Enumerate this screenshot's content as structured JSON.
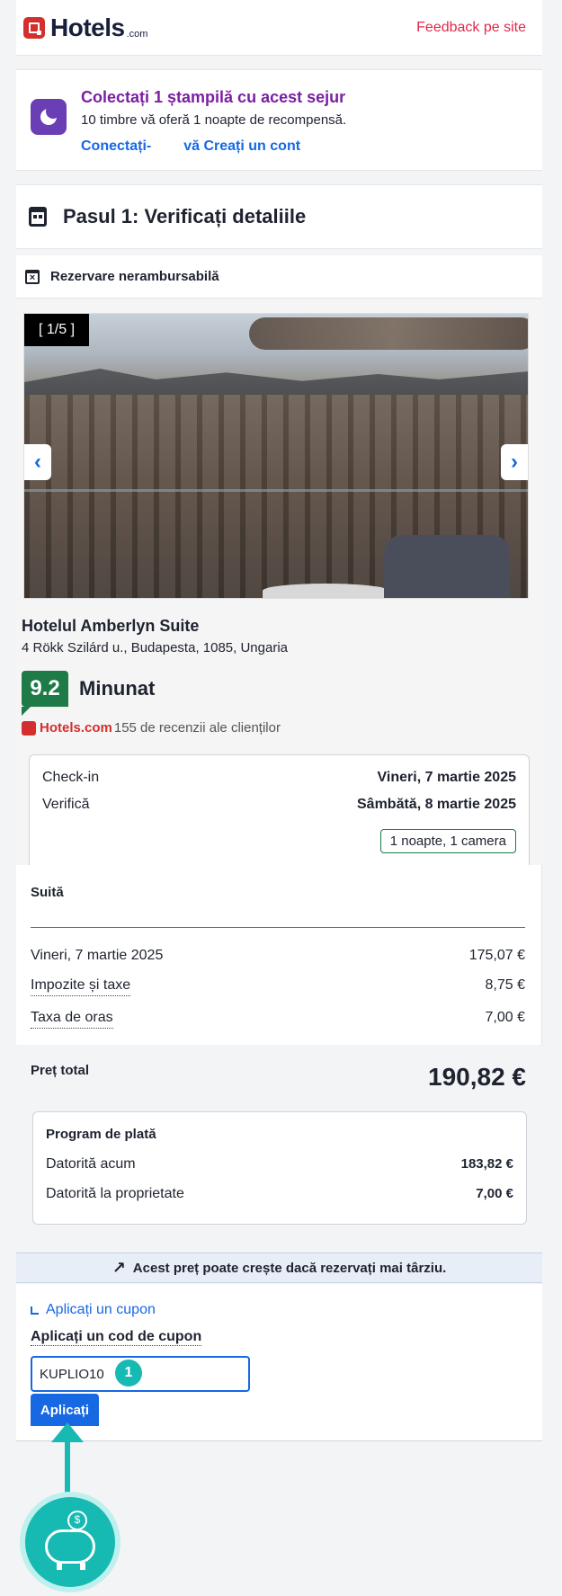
{
  "header": {
    "logo_text": "Hotels",
    "logo_suffix": ".com",
    "feedback_link": "Feedback pe site"
  },
  "loyalty": {
    "title": "Colectați 1 ștampilă cu acest sejur",
    "subtitle": "10 timbre vă oferă 1 noapte de recompensă.",
    "signin_link": "Conectați-",
    "create_link": "vă Creați un cont"
  },
  "step": {
    "title": "Pasul 1: Verificați detaliile"
  },
  "refund": {
    "label": "Rezervare nerambursabilă"
  },
  "gallery": {
    "counter": "[ 1/5 ]",
    "prev": "‹",
    "next": "›"
  },
  "hotel": {
    "name": "Hotelul Amberlyn Suite",
    "address": "4 Rökk Szilárd u., Budapesta, 1085, Ungaria",
    "score": "9.2",
    "rating_word": "Minunat",
    "review_brand": "Hotels.com",
    "review_text": "155 de recenzii ale clienților"
  },
  "stay": {
    "checkin_label": "Check-in",
    "checkin_value": "Vineri, 7 martie 2025",
    "checkout_label": "Verifică",
    "checkout_value": "Sâmbătă, 8 martie 2025",
    "summary": "1 noapte, 1 camera"
  },
  "price": {
    "room_type": "Suită",
    "lines": [
      {
        "label": "Vineri, 7 martie 2025",
        "value": "175,07 €"
      },
      {
        "label": "Impozite și taxe",
        "value": "8,75 €"
      },
      {
        "label": "Taxa de oras",
        "value": "7,00 €"
      }
    ],
    "total_label": "Preț total",
    "total_value": "190,82 €"
  },
  "payment": {
    "title": "Program de plată",
    "now_label": "Datorită acum",
    "now_value": "183,82 €",
    "property_label": "Datorită la proprietate",
    "property_value": "7,00 €"
  },
  "notice": {
    "text": "Acest preț poate crește dacă rezervați mai târziu.",
    "icon": "trend-up-icon"
  },
  "coupon": {
    "toggle": "Aplicați un cupon",
    "label": "Aplicați un cod de cupon",
    "value": "KUPLIO10",
    "apply": "Aplicați",
    "step_badge": "1"
  },
  "colors": {
    "brand_red": "#d32f2f",
    "link_blue": "#1668e3",
    "score_green": "#1e7a46",
    "annotation_teal": "#17b9b3",
    "loyalty_purple": "#7b1fa2"
  }
}
